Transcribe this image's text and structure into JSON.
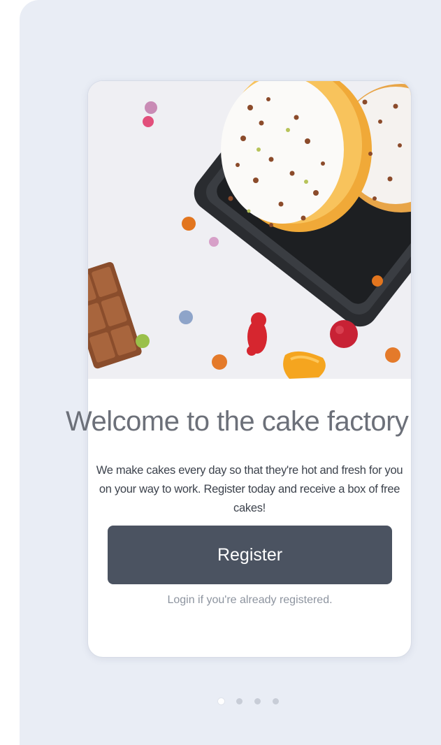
{
  "onboarding": {
    "title": "Welcome to the cake factory",
    "description": "We make cakes every day so that they're hot and fresh for you on your way to work. Register today and receive a box of free cakes!",
    "register_label": "Register",
    "login_label": "Login if you're already registered.",
    "hero_image": "donuts-and-candies-photo",
    "pagination": {
      "total_pages": 4,
      "active_page": 1
    }
  },
  "colors": {
    "background": "#e9edf5",
    "card": "#ffffff",
    "button": "#4b5361",
    "button_text": "#ffffff",
    "title_text": "#6c7079",
    "body_text": "#3d434d",
    "link_text": "#8d949f"
  }
}
